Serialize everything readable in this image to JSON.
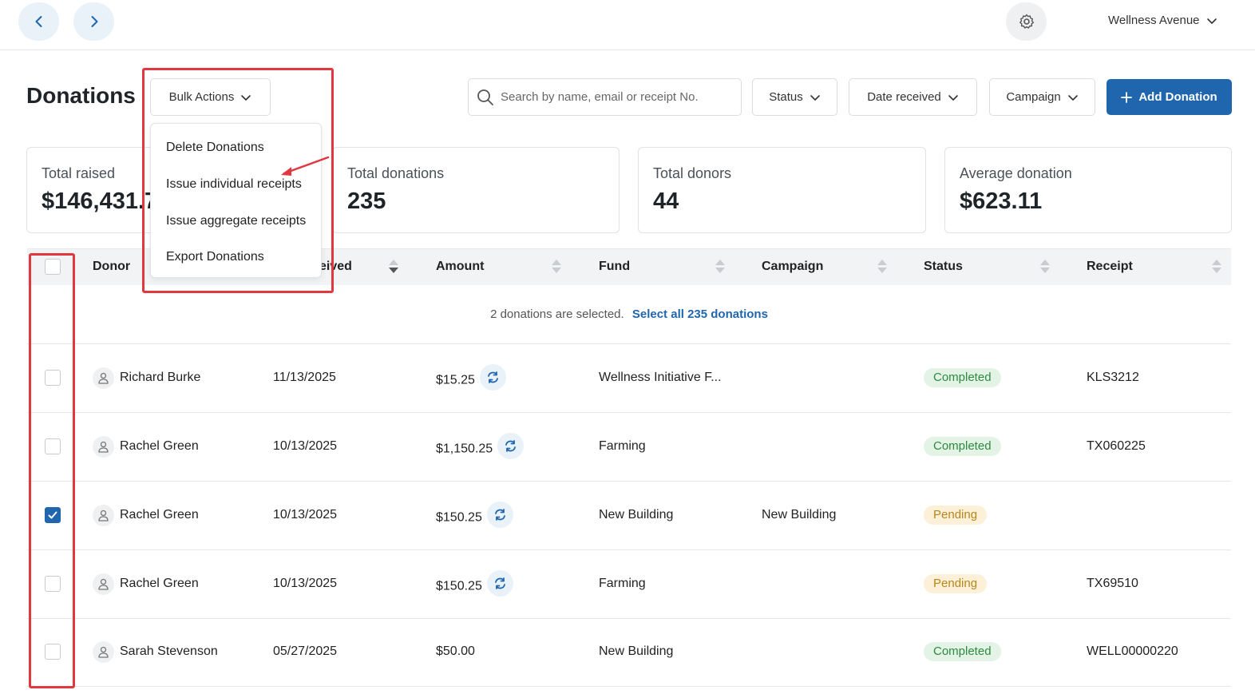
{
  "topbar": {
    "org_name": "Wellness Avenue"
  },
  "header": {
    "title": "Donations",
    "bulk_actions_label": "Bulk Actions",
    "search_placeholder": "Search by name, email or receipt No.",
    "filters": {
      "status": "Status",
      "date_received": "Date received",
      "campaign": "Campaign"
    },
    "add_label": "Add Donation"
  },
  "bulk_menu": {
    "items": [
      "Delete Donations",
      "Issue individual receipts",
      "Issue aggregate receipts",
      "Export Donations"
    ]
  },
  "stats": [
    {
      "label": "Total raised",
      "value": "$146,431.7"
    },
    {
      "label": "Total donations",
      "value": "235"
    },
    {
      "label": "Total donors",
      "value": "44"
    },
    {
      "label": "Average donation",
      "value": "$623.11"
    }
  ],
  "table": {
    "columns": {
      "donor": "Donor",
      "received": "eived",
      "amount": "Amount",
      "fund": "Fund",
      "campaign": "Campaign",
      "status": "Status",
      "receipt": "Receipt"
    },
    "selection": {
      "text": "2 donations are selected.",
      "link": "Select all 235 donations"
    },
    "rows": [
      {
        "checked": false,
        "donor": "Richard Burke",
        "date": "11/13/2025",
        "amount": "$15.25",
        "recurring": true,
        "fund": "Wellness Initiative F...",
        "campaign": "",
        "status": "Completed",
        "receipt": "KLS3212"
      },
      {
        "checked": false,
        "donor": "Rachel Green",
        "date": "10/13/2025",
        "amount": "$1,150.25",
        "recurring": true,
        "fund": "Farming",
        "campaign": "",
        "status": "Completed",
        "receipt": "TX060225"
      },
      {
        "checked": true,
        "donor": "Rachel Green",
        "date": "10/13/2025",
        "amount": "$150.25",
        "recurring": true,
        "fund": "New Building",
        "campaign": "New Building",
        "status": "Pending",
        "receipt": ""
      },
      {
        "checked": false,
        "donor": "Rachel Green",
        "date": "10/13/2025",
        "amount": "$150.25",
        "recurring": true,
        "fund": "Farming",
        "campaign": "",
        "status": "Pending",
        "receipt": "TX69510"
      },
      {
        "checked": false,
        "donor": "Sarah Stevenson",
        "date": "05/27/2025",
        "amount": "$50.00",
        "recurring": false,
        "fund": "New Building",
        "campaign": "",
        "status": "Completed",
        "receipt": "WELL00000220"
      }
    ]
  },
  "colors": {
    "accent": "#1f66ae",
    "annotation": "#e0383e",
    "completed": "#2d8a3e",
    "pending": "#b78619"
  }
}
